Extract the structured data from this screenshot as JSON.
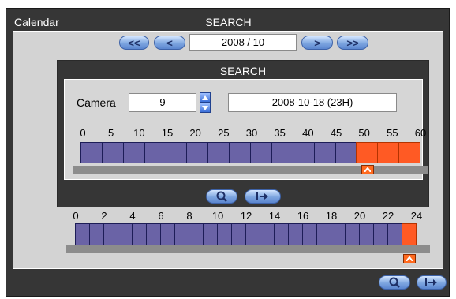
{
  "window": {
    "title_left": "Calendar",
    "title_center": "SEARCH"
  },
  "month_nav": {
    "prev_year_label": "<<",
    "prev_month_label": "<",
    "current": "2008 / 10",
    "next_month_label": ">",
    "next_year_label": ">>"
  },
  "dialog": {
    "title": "SEARCH",
    "camera_label": "Camera",
    "camera_value": "9",
    "datetime_value": "2008-10-18 (23H)",
    "minute_ticks": [
      "0",
      "5",
      "10",
      "15",
      "20",
      "25",
      "30",
      "35",
      "40",
      "45",
      "50",
      "55",
      "60"
    ],
    "minute_cells": [
      "p",
      "p",
      "p",
      "p",
      "p",
      "p",
      "p",
      "p",
      "p",
      "p",
      "p",
      "p",
      "p",
      "p",
      "p",
      "p",
      "p",
      "p",
      "p",
      "p",
      "p",
      "p",
      "p",
      "p",
      "p",
      "p",
      "p",
      "p",
      "p",
      "p",
      "p",
      "p",
      "p",
      "p",
      "p",
      "p",
      "p",
      "p",
      "p",
      "p",
      "p",
      "p",
      "p",
      "p",
      "p",
      "p",
      "p",
      "p",
      "p",
      "p",
      "p",
      "p",
      "p",
      "p",
      "p",
      "p",
      "p",
      "p",
      "p",
      "p",
      "p"
    ],
    "minute_marker_value": 50
  },
  "hour_ticks": [
    "0",
    "2",
    "4",
    "6",
    "8",
    "10",
    "12",
    "14",
    "16",
    "18",
    "20",
    "22",
    "24"
  ],
  "hour_marker_value": 23,
  "colors": {
    "recorded": "#6a63a6",
    "selected": "#ff5a24",
    "marker": "#ff6a1f",
    "button_accent": "#7ea6e0"
  },
  "icons": {
    "search": "magnifier-icon",
    "exit": "exit-arrow-icon",
    "up": "chevron-up-icon",
    "down": "chevron-down-icon"
  }
}
